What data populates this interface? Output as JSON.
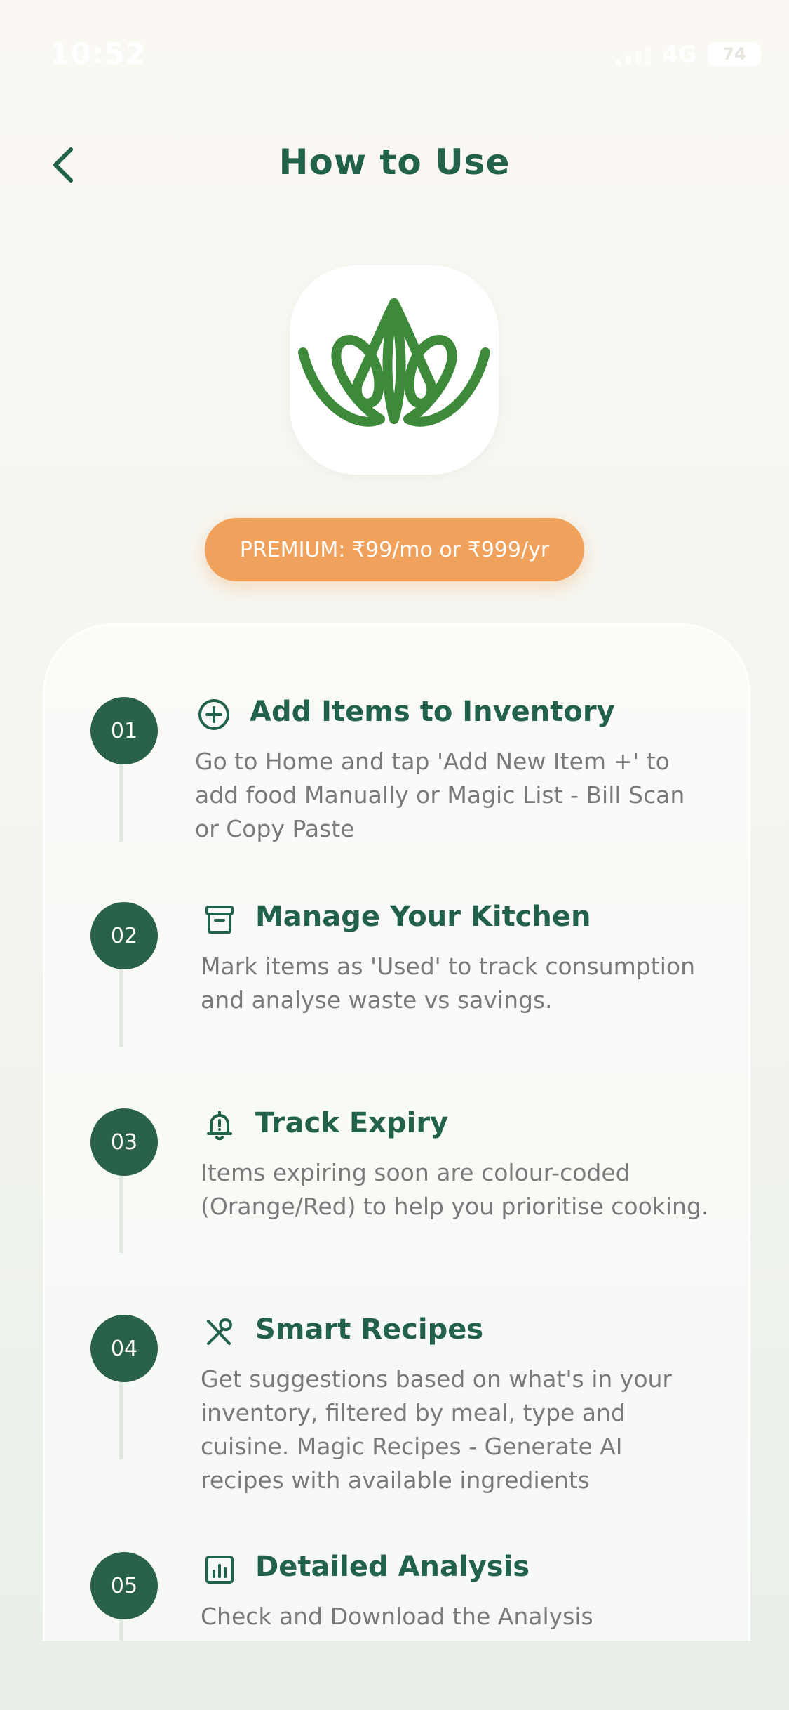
{
  "status_bar": {
    "time": "10:52",
    "network": "4G",
    "battery": "74"
  },
  "header": {
    "title": "How to Use"
  },
  "premium": {
    "label": "PREMIUM: ₹99/mo or ₹999/yr"
  },
  "steps": [
    {
      "number": "01",
      "icon": "plus-circle-icon",
      "title": "Add Items to Inventory",
      "description": "Go to Home and tap 'Add New Item +' to add food Manually or Magic List - Bill Scan or Copy Paste"
    },
    {
      "number": "02",
      "icon": "archive-box-icon",
      "title": "Manage Your Kitchen",
      "description": "Mark items as 'Used' to track consumption and analyse waste vs savings."
    },
    {
      "number": "03",
      "icon": "bell-alert-icon",
      "title": "Track Expiry",
      "description": "Items expiring soon are colour-coded (Orange/Red) to help you prioritise cooking."
    },
    {
      "number": "04",
      "icon": "fork-spoon-icon",
      "title": "Smart Recipes",
      "description": "Get suggestions based on what's in your inventory, filtered by meal, type and cuisine. Magic Recipes - Generate AI recipes with available ingredients"
    },
    {
      "number": "05",
      "icon": "chart-icon",
      "title": "Detailed Analysis",
      "description": "Check and Download the Analysis"
    }
  ],
  "colors": {
    "accent": "#22614a",
    "premium": "#f0a25d",
    "logo_green": "#3c8a3a"
  }
}
